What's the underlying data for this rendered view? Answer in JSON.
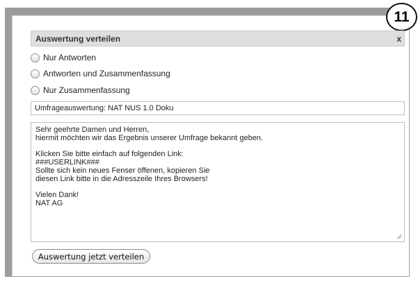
{
  "badge": "11",
  "dialog": {
    "title": "Auswertung verteilen",
    "close_label": "x"
  },
  "options": [
    {
      "label": "Nur Antworten",
      "selected": false
    },
    {
      "label": "Antworten und Zusammenfassung",
      "selected": false
    },
    {
      "label": "Nur Zusammenfassung",
      "selected": false
    }
  ],
  "subject_value": "Umfrageauswertung:  NAT NUS 1.0 Doku",
  "message_lines": [
    "Sehr geehrte Damen und Herren,",
    "hiermit möchten wir das Ergebnis unserer Umfrage bekannt geben.",
    "",
    "Klicken Sie bitte einfach auf folgenden Link:",
    "###USERLINK###",
    "Sollte sich kein neues Fenser öffenen, kopieren Sie",
    "diesen Link bitte in die Adresszeile Ihres Browsers!",
    "",
    "Vielen Dank!",
    "NAT AG"
  ],
  "send_button_label": "Auswertung jetzt verteilen"
}
